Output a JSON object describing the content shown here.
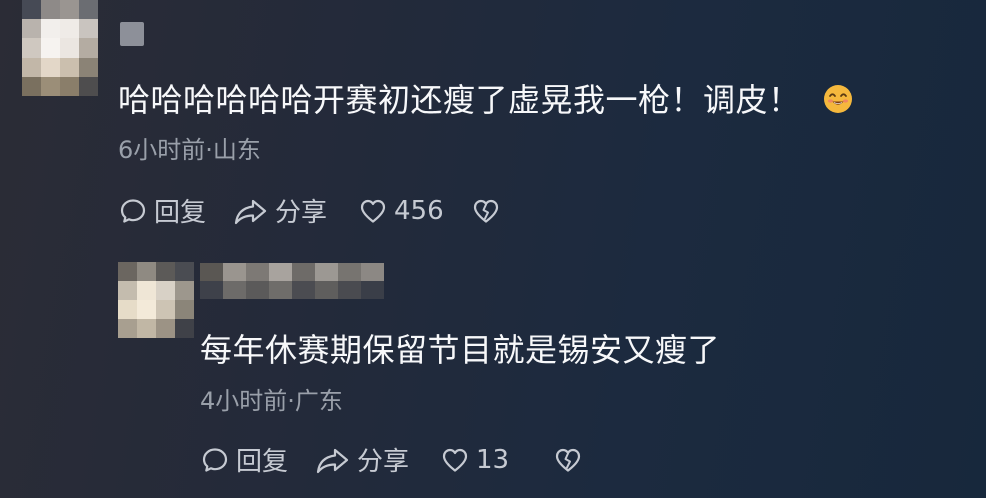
{
  "comments": [
    {
      "text": "哈哈哈哈哈哈开赛初还瘦了虚晃我一枪！调皮！",
      "emoji_icon": "grinning-smile-emoji-icon",
      "meta": "6小时前·山东",
      "actions": {
        "reply_label": "回复",
        "share_label": "分享",
        "like_count": "456"
      }
    },
    {
      "text": "每年休赛期保留节目就是锡安又瘦了",
      "meta": "4小时前·广东",
      "actions": {
        "reply_label": "回复",
        "share_label": "分享",
        "like_count": "13"
      }
    }
  ],
  "icons": {
    "reply": "reply-bubble-icon",
    "share": "share-arrow-icon",
    "like": "heart-outline-icon",
    "dislike": "broken-heart-icon"
  },
  "colors": {
    "comment_text": "#f7f8fa",
    "meta_text": "#9aa0aa",
    "action_text": "#c6cad2",
    "emoji": "#f5b83d"
  }
}
